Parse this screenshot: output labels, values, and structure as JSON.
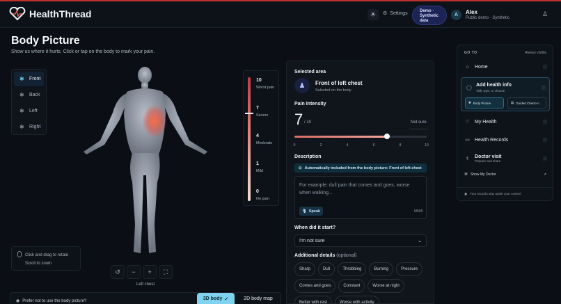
{
  "app": {
    "name": "HealthThread"
  },
  "header": {
    "settings_label": "Settings",
    "demo_badge": "Demo · Synthetic data",
    "user": {
      "initial": "A",
      "name": "Alex",
      "subtitle": "Public demo · Synthetic"
    }
  },
  "page": {
    "title": "Body Picture",
    "subtitle": "Show us where it hurts. Click or tap on the body to mark your pain."
  },
  "views": [
    {
      "label": "Front",
      "active": true
    },
    {
      "label": "Back",
      "active": false
    },
    {
      "label": "Left",
      "active": false
    },
    {
      "label": "Right",
      "active": false
    }
  ],
  "hint": {
    "line1": "Click and drag to rotate",
    "line2": "Scroll to zoom"
  },
  "view_caption": "Left chest",
  "bottom": {
    "preference": "Prefer not to use the body picture?",
    "toggle_3d": "3D body",
    "toggle_2d": "2D body map"
  },
  "pain_scale": [
    {
      "value": "10",
      "label": "Worst pain"
    },
    {
      "value": "7",
      "label": "Severe"
    },
    {
      "value": "4",
      "label": "Moderate"
    },
    {
      "value": "1",
      "label": "Mild"
    },
    {
      "value": "0",
      "label": "No pain"
    }
  ],
  "panel": {
    "selected_area_heading": "Selected area",
    "area_name": "Front of left chest",
    "area_sub": "Selected on the body",
    "intensity_heading": "Pain Intensity",
    "intensity_value": "7",
    "intensity_max": "/ 10",
    "intensity_fraction": 0.7,
    "not_sure": "Not sure",
    "ticks": [
      "0",
      "2",
      "4",
      "6",
      "8",
      "10"
    ],
    "description_heading": "Description",
    "auto_note": "Automatically included from the body picture: Front of left chest",
    "description_placeholder": "For example: dull pain that comes and goes, worse when walking...",
    "speak": "Speak",
    "char_count": "0/500",
    "start_heading": "When did it start?",
    "start_value": "I'm not sure",
    "details_heading": "Additional details",
    "details_optional": "(optional)",
    "chips": [
      "Sharp",
      "Dull",
      "Throbbing",
      "Burning",
      "Pressure",
      "Comes and goes",
      "Constant",
      "Worse at night",
      "Better with rest",
      "Worse with activity"
    ]
  },
  "nav": {
    "heading": "GO TO",
    "visibility": "Always visible",
    "home": "Home",
    "add_title": "Add health info",
    "add_sub": "Talk, type, or choose",
    "add_body_picture": "Body Picture",
    "add_guided": "Guided Check-in",
    "my_health": "My Health",
    "records": "Health Records",
    "doctor_title": "Doctor visit",
    "doctor_sub": "Prepare and share",
    "show_doctor": "Show My Doctor",
    "footer": "Your records stay under your control."
  },
  "colors": {
    "accent": "#7fd3ef",
    "pain": "#e0574d",
    "brand_bar": "#c0312e"
  }
}
